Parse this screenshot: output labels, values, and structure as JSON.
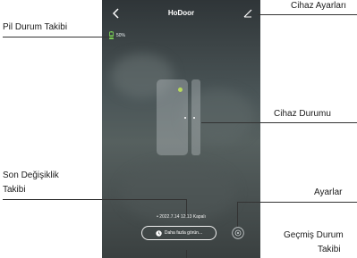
{
  "app": {
    "title": "HoDoor"
  },
  "status": {
    "battery_text": "50%"
  },
  "device": {
    "last_change": "• 2022.7.14 12:13 Kapalı"
  },
  "actions": {
    "more_label": "Daha fazla görün..."
  },
  "callouts": {
    "battery_tracking": "Pil Durum Takibi",
    "device_settings": "Cihaz Ayarları",
    "device_status": "Cihaz Durumu",
    "last_change_line1": "Son Değişiklik",
    "last_change_line2": "Takibi",
    "settings": "Ayarlar",
    "history_line1": "Geçmiş Durum",
    "history_line2": "Takibi"
  },
  "colors": {
    "led": "#b7d95c",
    "battery_green": "#7ed957",
    "annotation_line": "#333333"
  },
  "icons": [
    "back-icon",
    "edit-icon",
    "battery-icon",
    "clock-icon",
    "settings-gear-icon"
  ]
}
